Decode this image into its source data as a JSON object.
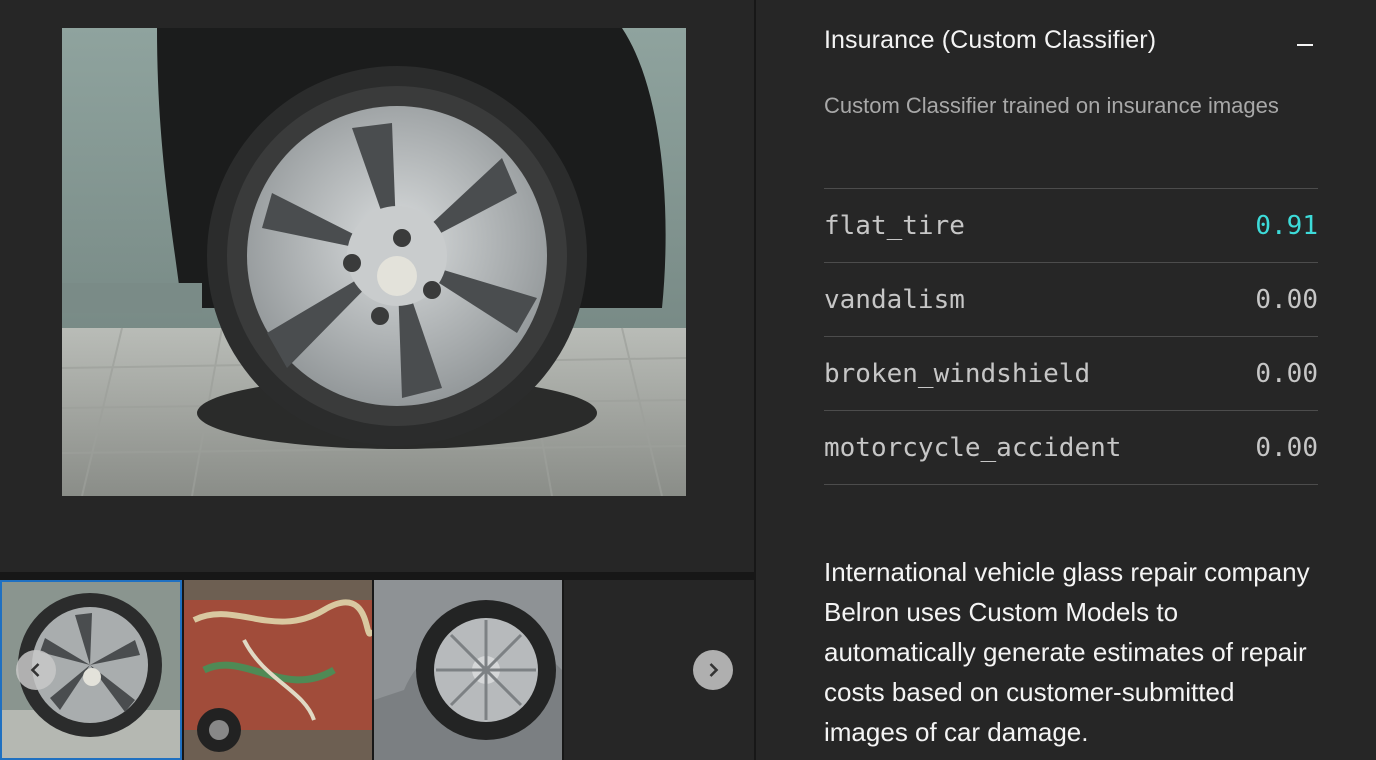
{
  "panel": {
    "title": "Insurance (Custom Classifier)",
    "description": "Custom Classifier trained on insurance images",
    "collapse_icon": "minus-icon"
  },
  "results": [
    {
      "label": "flat_tire",
      "score": "0.91"
    },
    {
      "label": "vandalism",
      "score": "0.00"
    },
    {
      "label": "broken_windshield",
      "score": "0.00"
    },
    {
      "label": "motorcycle_accident",
      "score": "0.00"
    }
  ],
  "blurb": "International vehicle glass repair company Belron uses Custom Models to automatically generate estimates of repair costs based on customer-submitted images of car damage.",
  "colors": {
    "background": "#262626",
    "top_score": "#3ddbd9",
    "selected_outline": "#1f70c1"
  },
  "carousel": {
    "prev_icon": "chevron-left-icon",
    "next_icon": "chevron-right-icon",
    "selected_index": 0
  }
}
